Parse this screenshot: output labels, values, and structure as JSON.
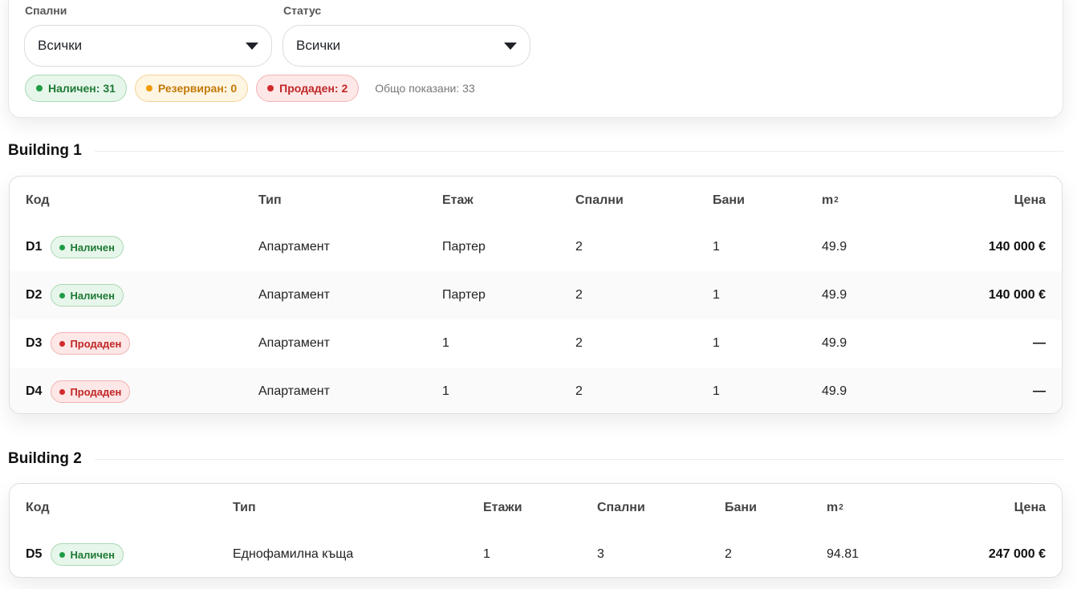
{
  "filters": {
    "bedrooms": {
      "label": "Спални",
      "value": "Всички"
    },
    "status": {
      "label": "Статус",
      "value": "Всички"
    },
    "chips": {
      "available": "Наличен: 31",
      "reserved": "Резервиран: 0",
      "sold": "Продаден: 2"
    },
    "total_shown": "Общо показани: 33"
  },
  "buildings": [
    {
      "title": "Building 1",
      "columns": {
        "code": "Код",
        "type": "Тип",
        "floor": "Етаж",
        "bedrooms": "Спални",
        "bathrooms": "Бани",
        "area": "m",
        "area_sup": "2",
        "price": "Цена"
      },
      "rows": [
        {
          "code": "D1",
          "status": "Наличен",
          "status_kind": "available",
          "type": "Апартамент",
          "floor": "Партер",
          "bedrooms": "2",
          "bathrooms": "1",
          "area": "49.9",
          "price": "140 000 €"
        },
        {
          "code": "D2",
          "status": "Наличен",
          "status_kind": "available",
          "type": "Апартамент",
          "floor": "Партер",
          "bedrooms": "2",
          "bathrooms": "1",
          "area": "49.9",
          "price": "140 000 €"
        },
        {
          "code": "D3",
          "status": "Продаден",
          "status_kind": "sold",
          "type": "Апартамент",
          "floor": "1",
          "bedrooms": "2",
          "bathrooms": "1",
          "area": "49.9",
          "price": "—"
        },
        {
          "code": "D4",
          "status": "Продаден",
          "status_kind": "sold",
          "type": "Апартамент",
          "floor": "1",
          "bedrooms": "2",
          "bathrooms": "1",
          "area": "49.9",
          "price": "—"
        }
      ]
    },
    {
      "title": "Building 2",
      "columns": {
        "code": "Код",
        "type": "Тип",
        "floors": "Етажи",
        "bedrooms": "Спални",
        "bathrooms": "Бани",
        "area": "m",
        "area_sup": "2",
        "price": "Цена"
      },
      "rows": [
        {
          "code": "D5",
          "status": "Наличен",
          "status_kind": "available",
          "type": "Еднофамилна къща",
          "floors": "1",
          "bedrooms": "3",
          "bathrooms": "2",
          "area": "94.81",
          "price": "247 000 €"
        }
      ]
    }
  ],
  "colors": {
    "available": "#1f9b45",
    "reserved": "#f29b0a",
    "sold": "#d12a2a"
  }
}
